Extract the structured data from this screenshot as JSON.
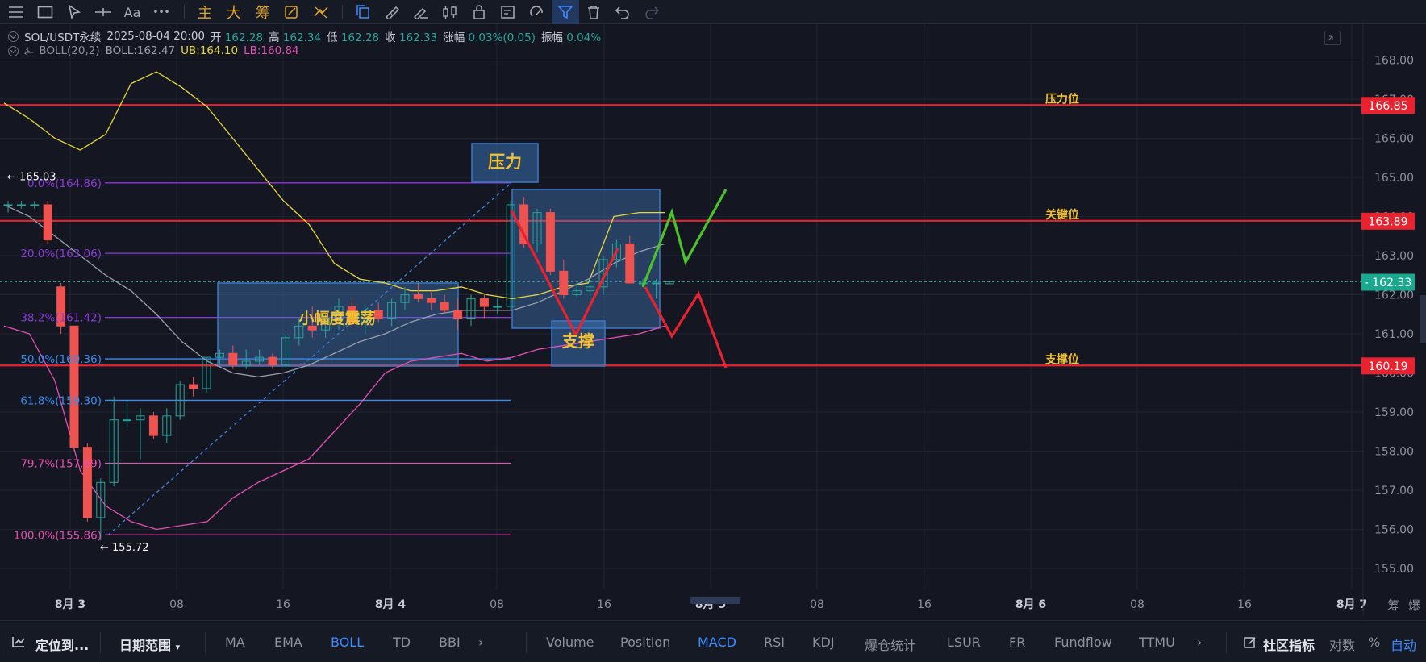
{
  "toolbar": {
    "labels": {
      "text_tool": "Aa",
      "more": "•••",
      "main": "主",
      "big": "大",
      "chips": "筹"
    }
  },
  "legend": {
    "symbol": "SOL/USDT永续",
    "datetime": "2025-08-04 20:00",
    "open_label": "开",
    "open": "162.28",
    "high_label": "高",
    "high": "162.34",
    "low_label": "低",
    "low": "162.28",
    "close_label": "收",
    "close": "162.33",
    "change_label": "涨幅",
    "change": "0.03%(0.05)",
    "amplitude_label": "振幅",
    "amplitude": "0.04%",
    "boll_name": "BOLL(20,2)",
    "boll_mid": "BOLL:162.47",
    "boll_ub": "UB:164.10",
    "boll_lb": "LB:160.84"
  },
  "colors": {
    "background": "#141722",
    "grid": "#1f2331",
    "up": "#26a69a",
    "down": "#ef5350",
    "resistance_line": "#e8222e",
    "boll_mid": "#9aa0ad",
    "boll_ub": "#e8d83a",
    "boll_lb": "#e54fb6",
    "fib_purple": "#8a3ad8",
    "fib_blue": "#3a8af0",
    "fib_pink": "#e84fb0",
    "annotation_yellow": "#f2c232",
    "box_blue": "#3a78c8",
    "current_price": "#1aa88f"
  },
  "chart_data": {
    "type": "candlestick",
    "price_axis": {
      "min": 155.0,
      "max": 168.0,
      "ticks": [
        "168.00",
        "167.00",
        "166.00",
        "165.00",
        "164.00",
        "163.00",
        "162.00",
        "161.00",
        "160.00",
        "159.00",
        "158.00",
        "157.00",
        "156.00",
        "155.00"
      ]
    },
    "time_axis": {
      "labels": [
        "8月 3",
        "08",
        "16",
        "8月 4",
        "08",
        "16",
        "8月 5",
        "08",
        "16",
        "8月 6",
        "08",
        "16",
        "8月 7"
      ]
    },
    "candles": [
      [
        164.3,
        164.4,
        164.1,
        164.3
      ],
      [
        164.3,
        164.4,
        164.2,
        164.3
      ],
      [
        164.3,
        164.4,
        164.2,
        164.3
      ],
      [
        164.3,
        164.4,
        163.3,
        163.4
      ],
      [
        162.2,
        162.3,
        161.0,
        161.2
      ],
      [
        161.2,
        161.2,
        158.0,
        158.1
      ],
      [
        158.1,
        158.2,
        156.2,
        156.3
      ],
      [
        156.3,
        157.3,
        155.72,
        157.2
      ],
      [
        157.2,
        159.4,
        157.1,
        158.8
      ],
      [
        158.8,
        159.3,
        158.6,
        158.8
      ],
      [
        158.8,
        159.1,
        157.8,
        158.9
      ],
      [
        158.9,
        159.0,
        158.3,
        158.4
      ],
      [
        158.4,
        159.1,
        158.2,
        158.9
      ],
      [
        158.9,
        159.8,
        158.8,
        159.7
      ],
      [
        159.7,
        159.9,
        159.4,
        159.6
      ],
      [
        159.6,
        160.4,
        159.5,
        160.4
      ],
      [
        160.4,
        160.6,
        160.2,
        160.5
      ],
      [
        160.5,
        160.7,
        160.1,
        160.2
      ],
      [
        160.2,
        160.6,
        160.1,
        160.3
      ],
      [
        160.3,
        160.6,
        160.2,
        160.4
      ],
      [
        160.4,
        160.5,
        160.1,
        160.2
      ],
      [
        160.2,
        161.0,
        160.1,
        160.9
      ],
      [
        160.9,
        161.4,
        160.7,
        161.2
      ],
      [
        161.2,
        161.7,
        160.9,
        161.1
      ],
      [
        161.1,
        161.5,
        160.9,
        161.4
      ],
      [
        161.4,
        161.9,
        161.1,
        161.7
      ],
      [
        161.7,
        161.9,
        161.2,
        161.3
      ],
      [
        161.3,
        161.7,
        161.0,
        161.6
      ],
      [
        161.6,
        161.8,
        161.3,
        161.4
      ],
      [
        161.4,
        161.9,
        161.2,
        161.8
      ],
      [
        161.8,
        162.2,
        161.6,
        162.0
      ],
      [
        162.0,
        162.3,
        161.8,
        161.9
      ],
      [
        161.9,
        162.1,
        161.6,
        161.8
      ],
      [
        161.8,
        162.0,
        161.5,
        161.6
      ],
      [
        161.6,
        161.9,
        161.1,
        161.4
      ],
      [
        161.4,
        162.0,
        161.2,
        161.9
      ],
      [
        161.9,
        162.0,
        161.4,
        161.7
      ],
      [
        161.7,
        161.9,
        161.5,
        161.7
      ],
      [
        161.7,
        164.4,
        161.6,
        164.3
      ],
      [
        164.3,
        164.5,
        163.2,
        163.3
      ],
      [
        163.3,
        164.2,
        163.1,
        164.1
      ],
      [
        164.1,
        164.2,
        162.5,
        162.6
      ],
      [
        162.6,
        162.9,
        161.9,
        162.0
      ],
      [
        162.0,
        162.3,
        161.9,
        162.1
      ],
      [
        162.1,
        162.4,
        161.8,
        162.2
      ],
      [
        162.2,
        163.0,
        162.0,
        162.9
      ],
      [
        162.9,
        163.4,
        162.7,
        163.3
      ],
      [
        163.3,
        163.5,
        162.3,
        162.3
      ],
      [
        162.3,
        162.4,
        162.2,
        162.3
      ],
      [
        162.3,
        162.4,
        161.9,
        162.3
      ],
      [
        162.28,
        162.34,
        162.28,
        162.33
      ]
    ],
    "boll_mid": [
      164.3,
      164.0,
      163.5,
      163.0,
      162.5,
      162.1,
      161.5,
      160.8,
      160.3,
      160.0,
      159.9,
      160.0,
      160.2,
      160.5,
      160.8,
      161.0,
      161.3,
      161.5,
      161.6,
      161.6,
      161.6,
      161.8,
      162.1,
      162.4,
      162.8,
      163.1,
      163.3
    ],
    "boll_ub": [
      166.9,
      166.5,
      166.0,
      165.7,
      166.1,
      167.4,
      167.7,
      167.3,
      166.8,
      166.0,
      165.2,
      164.4,
      163.8,
      162.8,
      162.4,
      162.3,
      162.1,
      162.1,
      162.2,
      162.0,
      161.9,
      162.0,
      162.2,
      162.3,
      164.0,
      164.1,
      164.1
    ],
    "boll_lb": [
      161.2,
      161.0,
      159.8,
      157.5,
      156.6,
      156.2,
      156.0,
      156.1,
      156.2,
      156.8,
      157.2,
      157.5,
      157.8,
      158.5,
      159.2,
      160.0,
      160.3,
      160.4,
      160.5,
      160.3,
      160.4,
      160.6,
      160.7,
      160.8,
      160.9,
      161.0,
      161.2
    ],
    "current_price": "162.33",
    "swing_high": "165.03",
    "swing_low": "155.72",
    "horizontal_levels": [
      {
        "label": "压力位",
        "price": "166.85"
      },
      {
        "label": "关键位",
        "price": "163.89"
      },
      {
        "label": "支撑位",
        "price": "160.19"
      }
    ],
    "fib_levels": [
      {
        "label": "0.0%(164.86)",
        "price": 164.86
      },
      {
        "label": "20.0%(163.06)",
        "price": 163.06
      },
      {
        "label": "38.2%(161.42)",
        "price": 161.42
      },
      {
        "label": "50.0%(160.36)",
        "price": 160.36
      },
      {
        "label": "61.8%(159.30)",
        "price": 159.3
      },
      {
        "label": "79.7%(157.69)",
        "price": 157.69
      },
      {
        "label": "100.0%(155.86)",
        "price": 155.86
      }
    ],
    "annotations": {
      "consolidation": "小幅度震荡",
      "pressure": "压力",
      "support": "支撑"
    }
  },
  "axis_corner": {
    "chips": "筹",
    "blast": "爆"
  },
  "bottom_bar": {
    "locate": "定位到...",
    "date_range": "日期范围",
    "main_indicators": [
      "MA",
      "EMA",
      "BOLL",
      "TD",
      "BBI"
    ],
    "sub_indicators": [
      "Volume",
      "Position",
      "MACD",
      "RSI",
      "KDJ",
      "爆仓统计",
      "LSUR",
      "FR",
      "Fundflow",
      "TTMU"
    ],
    "community": "社区指标",
    "log": "对数",
    "percent": "%",
    "auto": "自动"
  }
}
